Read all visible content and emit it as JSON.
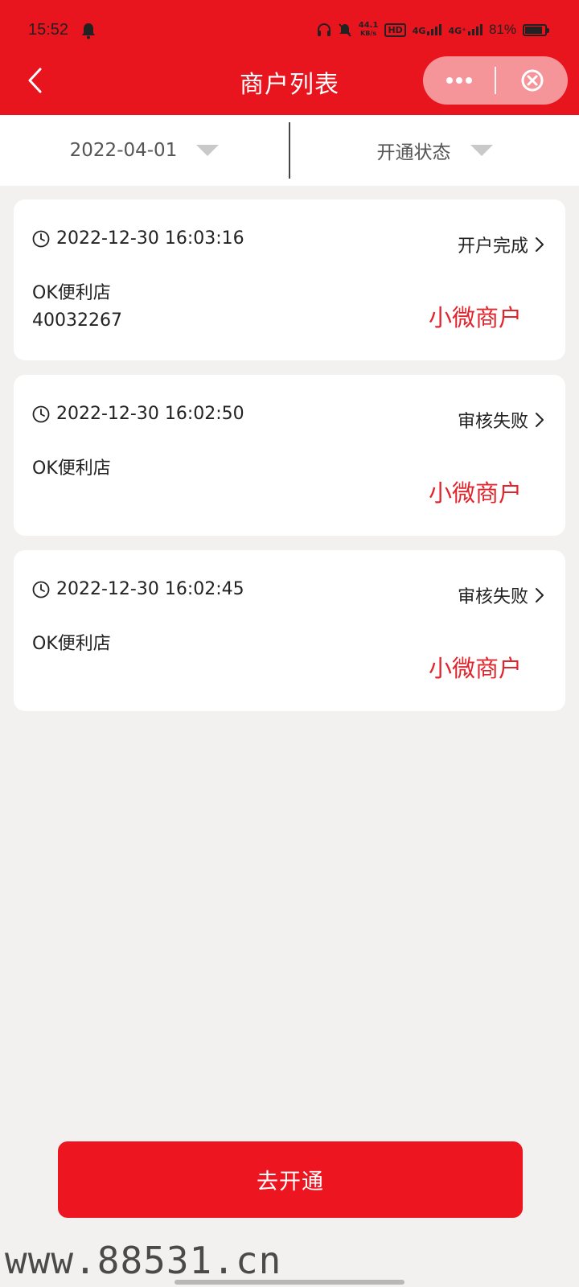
{
  "status_bar": {
    "time": "15:52",
    "net_speed": "44.1",
    "net_speed_unit": "KB/s",
    "hd": "HD",
    "net_1": "4G",
    "net_2": "4G⁺",
    "battery": "81%"
  },
  "nav": {
    "title": "商户列表"
  },
  "filters": {
    "date": "2022-04-01",
    "status": "开通状态"
  },
  "merchants": [
    {
      "time": "2022-12-30 16:03:16",
      "status": "开户完成",
      "store": "OK便利店",
      "account": "40032267",
      "type": "小微商户"
    },
    {
      "time": "2022-12-30 16:02:50",
      "status": "审核失败",
      "store": "OK便利店",
      "account": "",
      "type": "小微商户"
    },
    {
      "time": "2022-12-30 16:02:45",
      "status": "审核失败",
      "store": "OK便利店",
      "account": "",
      "type": "小微商户"
    }
  ],
  "cta": {
    "label": "去开通"
  },
  "watermark": "www.88531.cn",
  "colors": {
    "brand_red": "#e8141e",
    "merchant_type": "#e0252d"
  }
}
